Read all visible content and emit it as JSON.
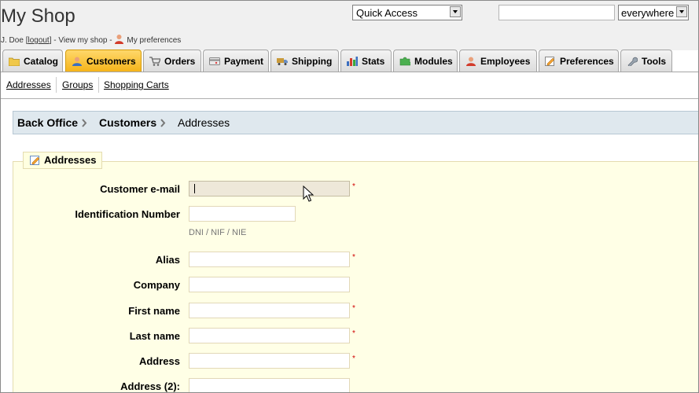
{
  "header": {
    "shop_title": "My Shop",
    "user_name": "J. Doe",
    "bracket_open": "[",
    "logout_label": "logout",
    "bracket_close": "]",
    "view_shop_label": "- View my shop -",
    "preferences_label": "My preferences",
    "quick_access": {
      "value": "Quick Access"
    },
    "search": {
      "value": "",
      "scope_value": "everywhere"
    }
  },
  "tabs": [
    {
      "label": "Catalog",
      "icon": "folder-icon",
      "active": false
    },
    {
      "label": "Customers",
      "icon": "customer-icon",
      "active": true
    },
    {
      "label": "Orders",
      "icon": "cart-icon",
      "active": false
    },
    {
      "label": "Payment",
      "icon": "card-icon",
      "active": false
    },
    {
      "label": "Shipping",
      "icon": "truck-icon",
      "active": false
    },
    {
      "label": "Stats",
      "icon": "bar-chart-icon",
      "active": false
    },
    {
      "label": "Modules",
      "icon": "puzzle-icon",
      "active": false
    },
    {
      "label": "Employees",
      "icon": "employee-icon",
      "active": false
    },
    {
      "label": "Preferences",
      "icon": "preferences-icon",
      "active": false
    },
    {
      "label": "Tools",
      "icon": "wrench-icon",
      "active": false
    }
  ],
  "subnav": [
    "Addresses",
    "Groups",
    "Shopping Carts"
  ],
  "breadcrumb": [
    "Back Office",
    "Customers",
    "Addresses"
  ],
  "form": {
    "legend": "Addresses",
    "fields": [
      {
        "label": "Customer e-mail",
        "value": "",
        "required": true
      },
      {
        "label": "Identification Number",
        "value": "",
        "required": false,
        "hint": "DNI / NIF / NIE"
      },
      {
        "label": "Alias",
        "value": "",
        "required": true
      },
      {
        "label": "Company",
        "value": "",
        "required": false
      },
      {
        "label": "First name",
        "value": "",
        "required": true
      },
      {
        "label": "Last name",
        "value": "",
        "required": true
      },
      {
        "label": "Address",
        "value": "",
        "required": true
      },
      {
        "label": "Address (2):",
        "value": "",
        "required": false
      }
    ],
    "required_mark": "*"
  },
  "colors": {
    "active_tab": "#f5b41a",
    "breadcrumb_bg": "#dfe8ee",
    "form_bg": "#ffffe6",
    "required": "#d00000"
  }
}
